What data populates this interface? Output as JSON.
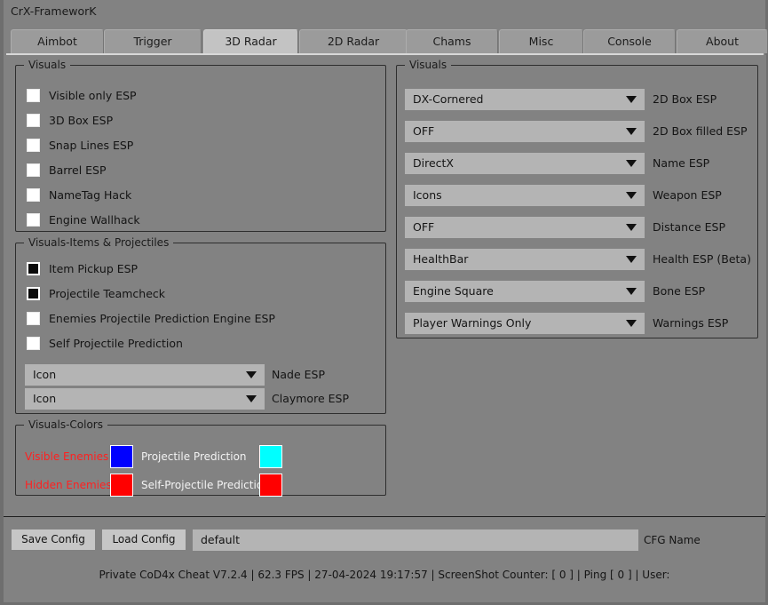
{
  "window": {
    "title": "CrX-FrameworK"
  },
  "tabs": [
    {
      "label": "Aimbot",
      "active": false
    },
    {
      "label": "Trigger",
      "active": false
    },
    {
      "label": "3D Radar",
      "active": true
    },
    {
      "label": "2D Radar",
      "active": false
    },
    {
      "label": "Chams",
      "active": false
    },
    {
      "label": "Misc",
      "active": false
    },
    {
      "label": "Console",
      "active": false
    },
    {
      "label": "About",
      "active": false
    }
  ],
  "left_panel": {
    "visuals": {
      "title": "Visuals",
      "checkboxes": [
        {
          "label": "Visible only ESP",
          "checked": false
        },
        {
          "label": "3D Box ESP",
          "checked": false
        },
        {
          "label": "Snap Lines ESP",
          "checked": false
        },
        {
          "label": "Barrel ESP",
          "checked": false
        },
        {
          "label": "NameTag Hack",
          "checked": false
        },
        {
          "label": "Engine Wallhack",
          "checked": false
        }
      ]
    },
    "items_projectiles": {
      "title": "Visuals-Items & Projectiles",
      "checkboxes": [
        {
          "label": "Item Pickup ESP",
          "checked": true
        },
        {
          "label": "Projectile Teamcheck",
          "checked": true
        },
        {
          "label": "Enemies Projectile Prediction Engine ESP",
          "checked": false
        },
        {
          "label": "Self Projectile Prediction",
          "checked": false
        }
      ],
      "combos": [
        {
          "value": "Icon",
          "caption": "Nade ESP"
        },
        {
          "value": "Icon",
          "caption": "Claymore ESP"
        }
      ]
    },
    "colors": {
      "title": "Visuals-Colors",
      "rows": [
        {
          "label": "Visible Enemies",
          "label_color": "#ff2020",
          "swatch": "#0000ff",
          "label2": "Projectile Prediction",
          "label2_color": "#f2f2f2",
          "swatch2": "#00ffff"
        },
        {
          "label": "Hidden Enemies",
          "label_color": "#ff2020",
          "swatch": "#ff0000",
          "label2": "Self-Projectile Prediction",
          "label2_color": "#f2f2f2",
          "swatch2": "#ff0000"
        }
      ]
    }
  },
  "right_panel": {
    "visuals": {
      "title": "Visuals",
      "combos": [
        {
          "value": "DX-Cornered",
          "caption": "2D Box ESP"
        },
        {
          "value": "OFF",
          "caption": "2D Box filled ESP"
        },
        {
          "value": "DirectX",
          "caption": "Name ESP"
        },
        {
          "value": "Icons",
          "caption": "Weapon ESP"
        },
        {
          "value": "OFF",
          "caption": "Distance ESP"
        },
        {
          "value": "HealthBar",
          "caption": "Health ESP (Beta)"
        },
        {
          "value": "Engine Square",
          "caption": "Bone ESP"
        },
        {
          "value": "Player Warnings Only",
          "caption": "Warnings ESP"
        }
      ]
    }
  },
  "config_bar": {
    "save_label": "Save Config",
    "load_label": "Load Config",
    "cfg_value": "default",
    "cfg_placeholder": "default",
    "cfg_name_label": "CFG Name"
  },
  "status_bar": {
    "text": "Private CoD4x Cheat V7.2.4  | 62.3 FPS |  27-04-2024 19:17:57  | ScreenShot Counter: [ 0 ] | Ping [ 0 ] | User:"
  }
}
